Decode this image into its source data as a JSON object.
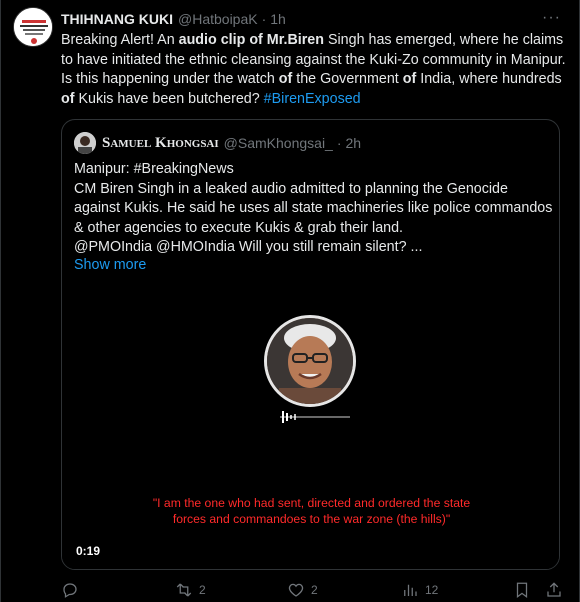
{
  "tweet": {
    "author_name": "THIHNANG KUKI",
    "author_handle": "@HatboipaK",
    "separator": "·",
    "time": "1h",
    "more": "···",
    "text_parts": [
      {
        "t": "Breaking Alert! An ",
        "b": false
      },
      {
        "t": "audio clip of Mr.Biren",
        "b": true
      },
      {
        "t": " Singh has emerged, where he claims to have initiated the ethnic cleansing against the Kuki-Zo community in Manipur. Is this happening under the watch ",
        "b": false
      },
      {
        "t": "of",
        "b": true
      },
      {
        "t": " the Government ",
        "b": false
      },
      {
        "t": "of",
        "b": true
      },
      {
        "t": " India, where hundreds ",
        "b": false
      },
      {
        "t": "of",
        "b": true
      },
      {
        "t": " Kukis have been butchered? ",
        "b": false
      }
    ],
    "hashtag": "#BirenExposed"
  },
  "quote": {
    "author_name": "Samuel Khongsai",
    "author_handle": "@SamKhongsai_",
    "separator": "·",
    "time": "2h",
    "lines": [
      "Manipur: #BreakingNews",
      "CM Biren Singh in a leaked audio admitted to planning the Genocide against Kukis. He said he uses all state machineries like police commandos & other agencies to execute Kukis & grab their land.",
      "@PMOIndia @HMOIndia Will you still remain silent? ..."
    ],
    "show_more": "Show more",
    "media": {
      "caption_line1": "\"I am the one who had sent, directed and ordered the state",
      "caption_line2": "forces and commandoes to the war zone (the hills)\"",
      "duration": "0:19"
    }
  },
  "actions": {
    "replies": "",
    "reposts": "2",
    "likes": "2",
    "views": "12"
  },
  "icons": {
    "reply": "reply-icon",
    "repost": "repost-icon",
    "like": "heart-icon",
    "views": "views-icon",
    "bookmark": "bookmark-icon",
    "share": "share-icon"
  }
}
